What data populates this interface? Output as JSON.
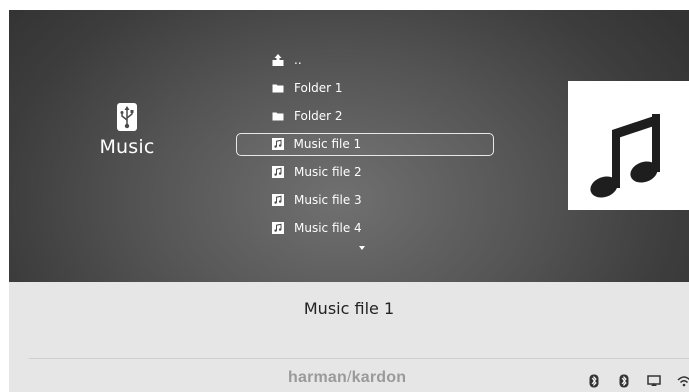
{
  "source": {
    "icon": "usb-icon",
    "label": "Music"
  },
  "browser": {
    "items": [
      {
        "icon": "parent-folder-icon",
        "label": ".."
      },
      {
        "icon": "folder-icon",
        "label": "Folder 1"
      },
      {
        "icon": "folder-icon",
        "label": "Folder 2"
      },
      {
        "icon": "music-file-icon",
        "label": "Music file 1",
        "selected": true
      },
      {
        "icon": "music-file-icon",
        "label": "Music file 2"
      },
      {
        "icon": "music-file-icon",
        "label": "Music file 3"
      },
      {
        "icon": "music-file-icon",
        "label": "Music file 4"
      }
    ],
    "more_indicator": "scroll-down-arrow-icon"
  },
  "album_art": {
    "icon": "music-note-icon"
  },
  "now_playing": {
    "title": "Music file 1"
  },
  "footer": {
    "brand_left": "harman",
    "brand_sep": "/",
    "brand_right": "kardon",
    "status_icons": [
      "bluetooth-icon",
      "bluetooth-icon",
      "screen-icon",
      "wifi-icon"
    ]
  },
  "colors": {
    "browser_background": "#4a4a4a",
    "footer_background": "#e6e6e6",
    "text_light": "#ffffff",
    "text_dark": "#222222",
    "brand": "#9a9a9a"
  }
}
